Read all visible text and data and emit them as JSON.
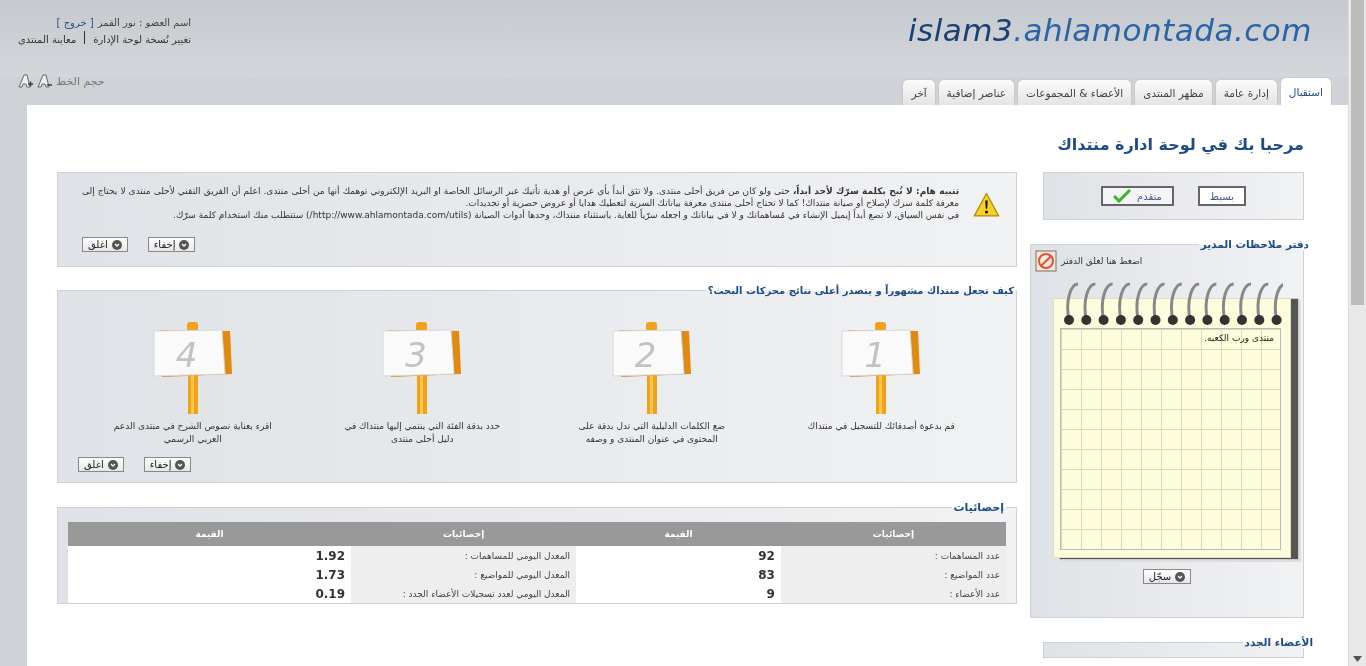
{
  "header": {
    "logo": {
      "name": "islam3",
      "domain": ".ahlamontada.com"
    },
    "member": {
      "label": "اسم العضو : نور القمر",
      "logout": "[ خروج ]"
    },
    "links": [
      "تغيير نُسخة لوحة الإدارة",
      "معاينة المنتدى"
    ],
    "font_size": {
      "label": "حجم الخط"
    }
  },
  "tabs": [
    {
      "label": "استقبال",
      "selected": true
    },
    {
      "label": "إدارة عامة",
      "selected": false
    },
    {
      "label": "مظهر المنتدى",
      "selected": false
    },
    {
      "label": "الأعضاء & المجموعات",
      "selected": false
    },
    {
      "label": "عناصر إضافية",
      "selected": false
    },
    {
      "label": "آخر",
      "selected": false
    }
  ],
  "page_title": "مرحبا بك في لوحة ادارة منتداك",
  "modes": [
    {
      "label": "بسيط",
      "selected": false
    },
    {
      "label": "متقدم",
      "selected": true
    }
  ],
  "notice": {
    "paragraphs": [
      "**تنبيه هام: لا تُبح بكلمة سرّك لأحد أبداً،** حتى ولو كان من فريق أحلى منتدى. ولا تثق أبداً بأي عرض أو هدية تأتيك عبر الرسائل الخاصة او البريد الإلكتروني توهمك أنها من أحلى منتدى. اعلم أن الفريق التقني لأحلى منتدى لا يحتاج إلى معرفة كلمة سرك لإصلاح أو صيانة منتداك! كما لا تحتاج أحلى منتدى معرفة بياناتك السرية لتعطيك هدايا أو عروض حصرية أو تجديدات.",
      "في نفس السياق، لا تضع أبداً إيميل الإنشاء في مُساهماتك و لا في بياناتك و اجعله سرّياً للغاية. باستثناء منتداك، وحدها أدوات الصيانة (http://www.ahlamontada.com/utils/) ستتطلب منك استخدام كلمة سرّك."
    ],
    "buttons": [
      "إخفاء",
      "اغلق"
    ]
  },
  "seo": {
    "title": "كيف تجعل منتداك مشهوراً و يتصدر أعلى نتائج محركات البحث؟",
    "steps": [
      {
        "number": "1",
        "text": "قم بدعوة أصدقائك للتسجيل في منتداك"
      },
      {
        "number": "2",
        "text": "ضع الكلمات الدليلية التي تدل بدقة على المحتوى في عنوان المنتدى و وصفه"
      },
      {
        "number": "3",
        "text": "حدد بدقة الفئة التي ينتمي إليها منتداك في دليل أحلى منتدى"
      },
      {
        "number": "4",
        "text": "اقرء بعناية نصوص الشرح في منتدى الدعم العربي الرسمي"
      }
    ],
    "buttons": [
      "إخفاء",
      "اغلق"
    ]
  },
  "stats": {
    "title": "إحصائيات",
    "columns": [
      "إحصائيات",
      "القيمة",
      "إحصائيات",
      "القيمة"
    ],
    "rows": [
      [
        "عدد المساهمات :",
        "92",
        "المعدل اليومي للمساهمات :",
        "1.92"
      ],
      [
        "عدد المواضيع :",
        "83",
        "المعدل اليومي للمواضيع :",
        "1.73"
      ],
      [
        "عدد الأعضاء :",
        "9",
        "المعدل اليومي لعدد تسجيلات الأعضاء الجدد :",
        "0.19"
      ]
    ]
  },
  "notebook": {
    "title": "دفتر ملاحظات المدير",
    "close": "اضغط هنا لغلق الدفتر",
    "note": "منتدى ورب الكعبه.",
    "button": "سجّل"
  },
  "new_members": {
    "title": "الأعضاء الجدد"
  }
}
